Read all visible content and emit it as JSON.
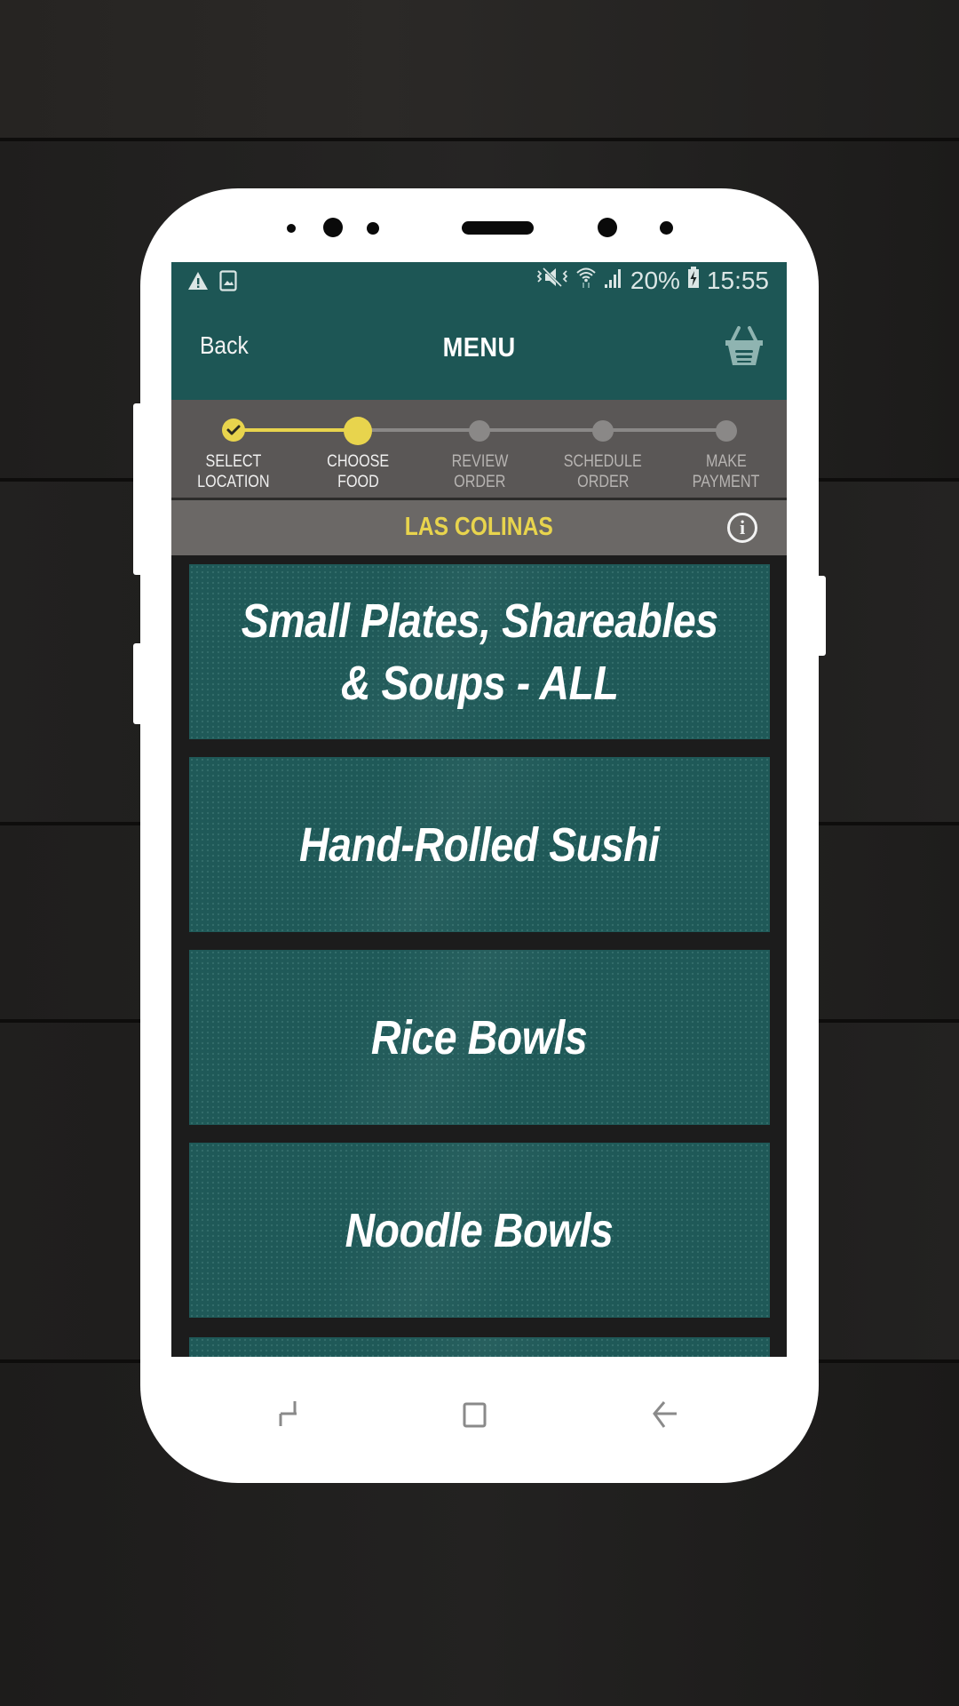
{
  "status_bar": {
    "left_icons": [
      "warning-icon",
      "image-icon"
    ],
    "right_icons": [
      "vibrate-mute-icon",
      "wifi-icon",
      "signal-icon"
    ],
    "battery_percent": "20%",
    "battery_icon": "battery-charging-icon",
    "time": "15:55"
  },
  "app_bar": {
    "back_label": "Back",
    "title": "MENU",
    "cart_icon": "basket-icon"
  },
  "progress": {
    "current_step": 2,
    "total_steps": 5,
    "steps": [
      {
        "line1": "SELECT",
        "line2": "LOCATION",
        "state": "completed"
      },
      {
        "line1": "CHOOSE",
        "line2": "FOOD",
        "state": "current"
      },
      {
        "line1": "REVIEW",
        "line2": "ORDER",
        "state": "upcoming"
      },
      {
        "line1": "SCHEDULE",
        "line2": "ORDER",
        "state": "upcoming"
      },
      {
        "line1": "MAKE",
        "line2": "PAYMENT",
        "state": "upcoming"
      }
    ],
    "colors": {
      "active": "#e8d44d",
      "inactive": "#8a8887"
    }
  },
  "location": {
    "name": "LAS COLINAS",
    "info_icon": "i"
  },
  "menu": {
    "categories": [
      {
        "line1": "Small Plates, Shareables",
        "line2": "& Soups - ALL"
      },
      {
        "line1": "Hand-Rolled Sushi",
        "line2": ""
      },
      {
        "line1": "Rice Bowls",
        "line2": ""
      },
      {
        "line1": "Noodle Bowls",
        "line2": ""
      },
      {
        "line1": "",
        "line2": ""
      }
    ]
  },
  "nav_bar": {
    "buttons": [
      "recents-icon",
      "home-icon",
      "back-arrow-icon"
    ]
  },
  "theme": {
    "primary": "#1d5655",
    "tile": "#1f5958",
    "accent": "#e8d44d",
    "progress_bg": "#5a5756",
    "location_bg": "#6b6866"
  }
}
